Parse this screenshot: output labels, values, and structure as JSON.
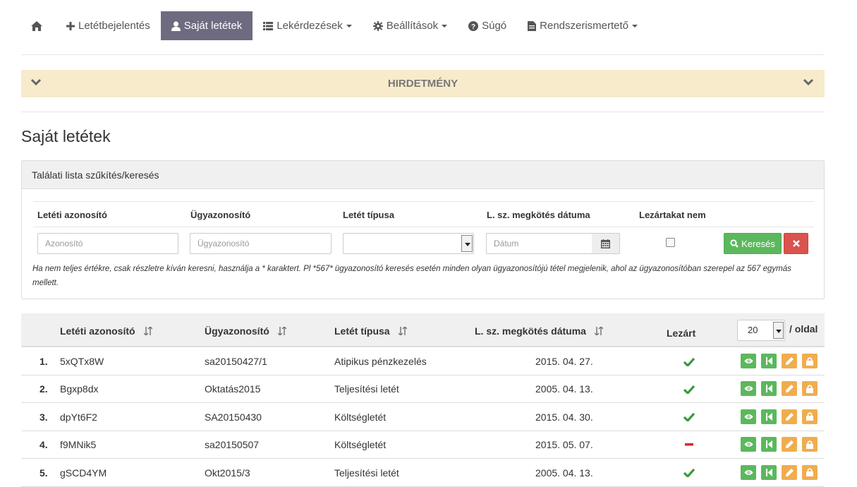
{
  "nav": {
    "items": [
      {
        "label": "",
        "icon": "home-icon",
        "active": false
      },
      {
        "label": "Letétbejelentés",
        "icon": "plus-icon",
        "active": false
      },
      {
        "label": "Saját letétek",
        "icon": "user-icon",
        "active": true
      },
      {
        "label": "Lekérdezések",
        "icon": "list-icon",
        "active": false,
        "dropdown": true
      },
      {
        "label": "Beállítások",
        "icon": "gear-icon",
        "active": false,
        "dropdown": true
      },
      {
        "label": "Súgó",
        "icon": "question-circle-icon",
        "active": false
      },
      {
        "label": "Rendszerismertető",
        "icon": "document-icon",
        "active": false,
        "dropdown": true
      }
    ]
  },
  "announcement": {
    "title": "HIRDETMÉNY"
  },
  "page": {
    "title": "Saját letétek"
  },
  "filter": {
    "heading": "Találati lista szűkítés/keresés",
    "labels": {
      "deposit_id": "Letéti azonosító",
      "case_id": "Ügyazonosító",
      "deposit_type": "Letét típusa",
      "contract_date": "L. sz. megkötés dátuma",
      "closed_not": "Lezártakat nem"
    },
    "placeholders": {
      "deposit_id": "Azonosító",
      "case_id": "Ügyazonosító",
      "contract_date": "Dátum"
    },
    "deposit_type_value": "",
    "closed_not_checked": false,
    "search_label": "Keresés",
    "hint": "Ha nem teljes értékre, csak részletre kíván keresni, használja a * karaktert. Pl *567* ügyazonosító keresés esetén minden olyan ügyazonosítójú tétel megjelenik, ahol az ügyazonosítóban szerepel az 567 egymás mellett."
  },
  "table": {
    "columns": {
      "deposit_id": "Letéti azonosító",
      "case_id": "Ügyazonosító",
      "deposit_type": "Letét típusa",
      "contract_date": "L. sz. megkötés dátuma",
      "closed": "Lezárt"
    },
    "per_page_value": "20",
    "per_page_label": "/ oldal",
    "rows": [
      {
        "num": "1.",
        "deposit_id": "5xQTx8W",
        "case_id": "sa20150427/1",
        "type": "Atipikus pénzkezelés",
        "date": "2015. 04. 27.",
        "closed": true
      },
      {
        "num": "2.",
        "deposit_id": "Bgxp8dx",
        "case_id": "Oktatás2015",
        "type": "Teljesítési letét",
        "date": "2005. 04. 13.",
        "closed": true
      },
      {
        "num": "3.",
        "deposit_id": "dpYt6F2",
        "case_id": "SA20150430",
        "type": "Költségletét",
        "date": "2015. 04. 30.",
        "closed": true
      },
      {
        "num": "4.",
        "deposit_id": "f9MNik5",
        "case_id": "sa20150507",
        "type": "Költségletét",
        "date": "2015. 05. 07.",
        "closed": false
      },
      {
        "num": "5.",
        "deposit_id": "gSCD4YM",
        "case_id": "Okt2015/3",
        "type": "Teljesítési letét",
        "date": "2005. 04. 13.",
        "closed": true
      }
    ]
  },
  "colors": {
    "accent_active": "#6e6b80",
    "success": "#5cb85c",
    "warning": "#f0ad4e",
    "danger": "#d9534f",
    "announce_bg": "#f7ebcc"
  }
}
